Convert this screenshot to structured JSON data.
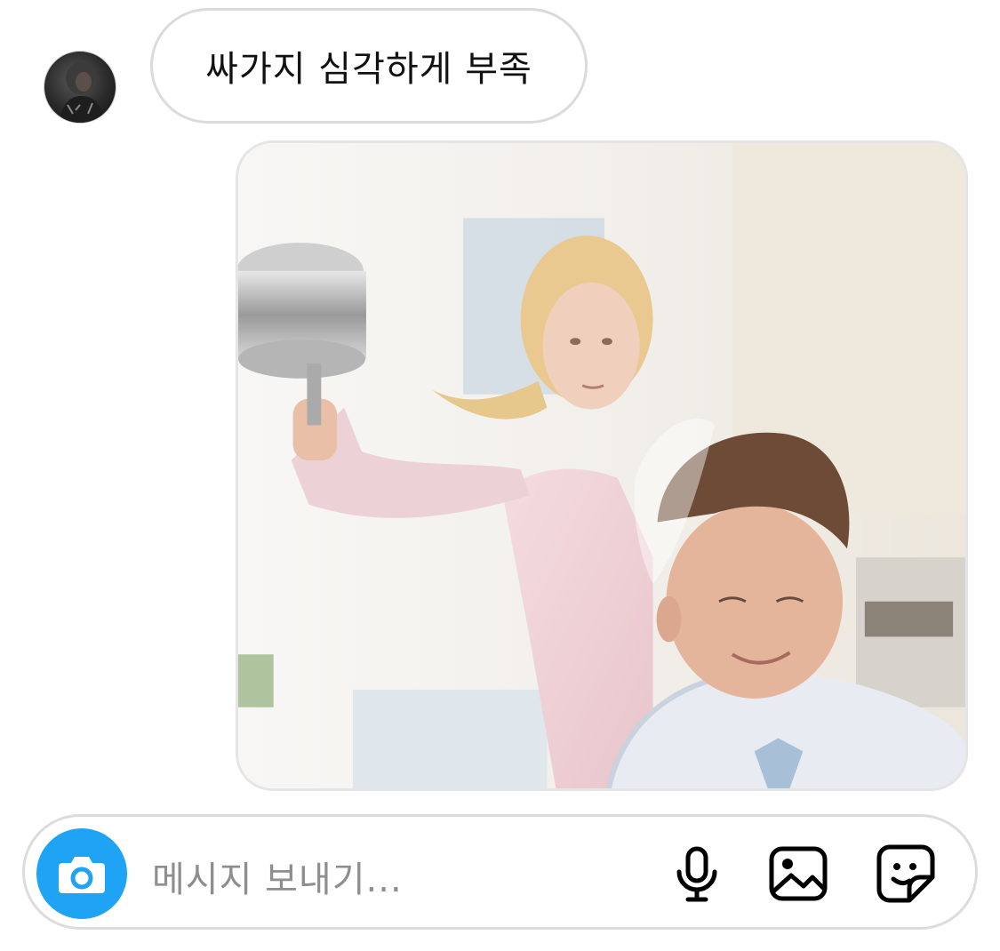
{
  "thread": {
    "incoming_message": {
      "text": "싸가지 심각하게 부족",
      "avatar_icon": "user-avatar"
    },
    "outgoing_image": {
      "kind": "photo",
      "description_icon": "photo-attachment"
    }
  },
  "composer": {
    "placeholder": "메시지 보내기...",
    "camera_icon": "camera-icon",
    "mic_icon": "microphone-icon",
    "gallery_icon": "image-icon",
    "sticker_icon": "sticker-icon",
    "accent_color": "#1fa3f5"
  }
}
